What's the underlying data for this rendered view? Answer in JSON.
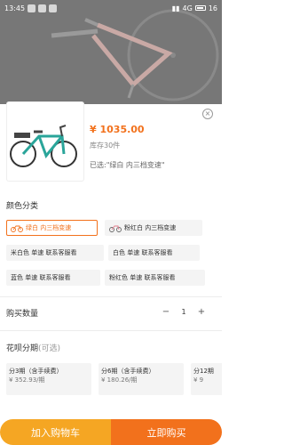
{
  "status_bar": {
    "time": "13:45",
    "network": "4G",
    "battery": "16"
  },
  "product": {
    "price": "¥ 1035.00",
    "stock": "库存30件",
    "selected": "已选:\"绿白 内三档变速\""
  },
  "color_section": {
    "title": "颜色分类",
    "options": [
      "绿白 内三档变速",
      "粉红白 内三档变速",
      "米白色 单速 联系客服看",
      "白色 单速 联系客服看",
      "蓝色 单速 联系客服看",
      "粉红色 单速 联系客服看"
    ],
    "selected_index": 0
  },
  "quantity": {
    "title": "购买数量",
    "minus": "−",
    "value": "1",
    "plus": "+"
  },
  "installment": {
    "title": "花呗分期",
    "subtitle": "(可选)",
    "options": [
      {
        "label": "分3期（含手续费）",
        "amount": "¥ 352.93/期"
      },
      {
        "label": "分6期（含手续费）",
        "amount": "¥ 180.26/期"
      },
      {
        "label": "分12期",
        "amount": "¥ 9"
      }
    ]
  },
  "actions": {
    "add_to_cart": "加入购物车",
    "buy_now": "立即购买"
  },
  "colors": {
    "accent": "#f2711c",
    "cart": "#f5a623",
    "frame_teal": "#2aa59a"
  }
}
